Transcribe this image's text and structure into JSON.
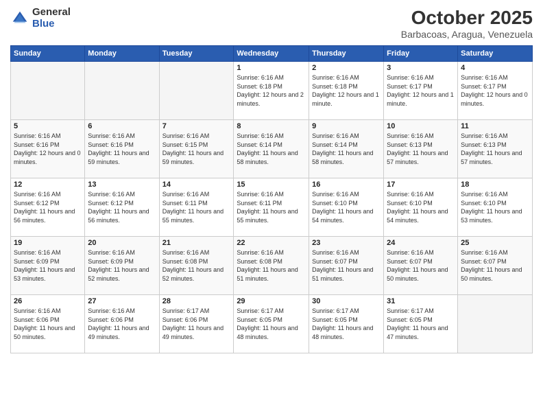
{
  "logo": {
    "general": "General",
    "blue": "Blue"
  },
  "header": {
    "month": "October 2025",
    "location": "Barbacoas, Aragua, Venezuela"
  },
  "weekdays": [
    "Sunday",
    "Monday",
    "Tuesday",
    "Wednesday",
    "Thursday",
    "Friday",
    "Saturday"
  ],
  "weeks": [
    [
      {
        "day": "",
        "empty": true
      },
      {
        "day": "",
        "empty": true
      },
      {
        "day": "",
        "empty": true
      },
      {
        "day": "1",
        "sunrise": "6:16 AM",
        "sunset": "6:18 PM",
        "daylight": "12 hours and 2 minutes."
      },
      {
        "day": "2",
        "sunrise": "6:16 AM",
        "sunset": "6:18 PM",
        "daylight": "12 hours and 1 minute."
      },
      {
        "day": "3",
        "sunrise": "6:16 AM",
        "sunset": "6:17 PM",
        "daylight": "12 hours and 1 minute."
      },
      {
        "day": "4",
        "sunrise": "6:16 AM",
        "sunset": "6:17 PM",
        "daylight": "12 hours and 0 minutes."
      }
    ],
    [
      {
        "day": "5",
        "sunrise": "6:16 AM",
        "sunset": "6:16 PM",
        "daylight": "12 hours and 0 minutes."
      },
      {
        "day": "6",
        "sunrise": "6:16 AM",
        "sunset": "6:16 PM",
        "daylight": "11 hours and 59 minutes."
      },
      {
        "day": "7",
        "sunrise": "6:16 AM",
        "sunset": "6:15 PM",
        "daylight": "11 hours and 59 minutes."
      },
      {
        "day": "8",
        "sunrise": "6:16 AM",
        "sunset": "6:14 PM",
        "daylight": "11 hours and 58 minutes."
      },
      {
        "day": "9",
        "sunrise": "6:16 AM",
        "sunset": "6:14 PM",
        "daylight": "11 hours and 58 minutes."
      },
      {
        "day": "10",
        "sunrise": "6:16 AM",
        "sunset": "6:13 PM",
        "daylight": "11 hours and 57 minutes."
      },
      {
        "day": "11",
        "sunrise": "6:16 AM",
        "sunset": "6:13 PM",
        "daylight": "11 hours and 57 minutes."
      }
    ],
    [
      {
        "day": "12",
        "sunrise": "6:16 AM",
        "sunset": "6:12 PM",
        "daylight": "11 hours and 56 minutes."
      },
      {
        "day": "13",
        "sunrise": "6:16 AM",
        "sunset": "6:12 PM",
        "daylight": "11 hours and 56 minutes."
      },
      {
        "day": "14",
        "sunrise": "6:16 AM",
        "sunset": "6:11 PM",
        "daylight": "11 hours and 55 minutes."
      },
      {
        "day": "15",
        "sunrise": "6:16 AM",
        "sunset": "6:11 PM",
        "daylight": "11 hours and 55 minutes."
      },
      {
        "day": "16",
        "sunrise": "6:16 AM",
        "sunset": "6:10 PM",
        "daylight": "11 hours and 54 minutes."
      },
      {
        "day": "17",
        "sunrise": "6:16 AM",
        "sunset": "6:10 PM",
        "daylight": "11 hours and 54 minutes."
      },
      {
        "day": "18",
        "sunrise": "6:16 AM",
        "sunset": "6:10 PM",
        "daylight": "11 hours and 53 minutes."
      }
    ],
    [
      {
        "day": "19",
        "sunrise": "6:16 AM",
        "sunset": "6:09 PM",
        "daylight": "11 hours and 53 minutes."
      },
      {
        "day": "20",
        "sunrise": "6:16 AM",
        "sunset": "6:09 PM",
        "daylight": "11 hours and 52 minutes."
      },
      {
        "day": "21",
        "sunrise": "6:16 AM",
        "sunset": "6:08 PM",
        "daylight": "11 hours and 52 minutes."
      },
      {
        "day": "22",
        "sunrise": "6:16 AM",
        "sunset": "6:08 PM",
        "daylight": "11 hours and 51 minutes."
      },
      {
        "day": "23",
        "sunrise": "6:16 AM",
        "sunset": "6:07 PM",
        "daylight": "11 hours and 51 minutes."
      },
      {
        "day": "24",
        "sunrise": "6:16 AM",
        "sunset": "6:07 PM",
        "daylight": "11 hours and 50 minutes."
      },
      {
        "day": "25",
        "sunrise": "6:16 AM",
        "sunset": "6:07 PM",
        "daylight": "11 hours and 50 minutes."
      }
    ],
    [
      {
        "day": "26",
        "sunrise": "6:16 AM",
        "sunset": "6:06 PM",
        "daylight": "11 hours and 50 minutes."
      },
      {
        "day": "27",
        "sunrise": "6:16 AM",
        "sunset": "6:06 PM",
        "daylight": "11 hours and 49 minutes."
      },
      {
        "day": "28",
        "sunrise": "6:17 AM",
        "sunset": "6:06 PM",
        "daylight": "11 hours and 49 minutes."
      },
      {
        "day": "29",
        "sunrise": "6:17 AM",
        "sunset": "6:05 PM",
        "daylight": "11 hours and 48 minutes."
      },
      {
        "day": "30",
        "sunrise": "6:17 AM",
        "sunset": "6:05 PM",
        "daylight": "11 hours and 48 minutes."
      },
      {
        "day": "31",
        "sunrise": "6:17 AM",
        "sunset": "6:05 PM",
        "daylight": "11 hours and 47 minutes."
      },
      {
        "day": "",
        "empty": true
      }
    ]
  ]
}
